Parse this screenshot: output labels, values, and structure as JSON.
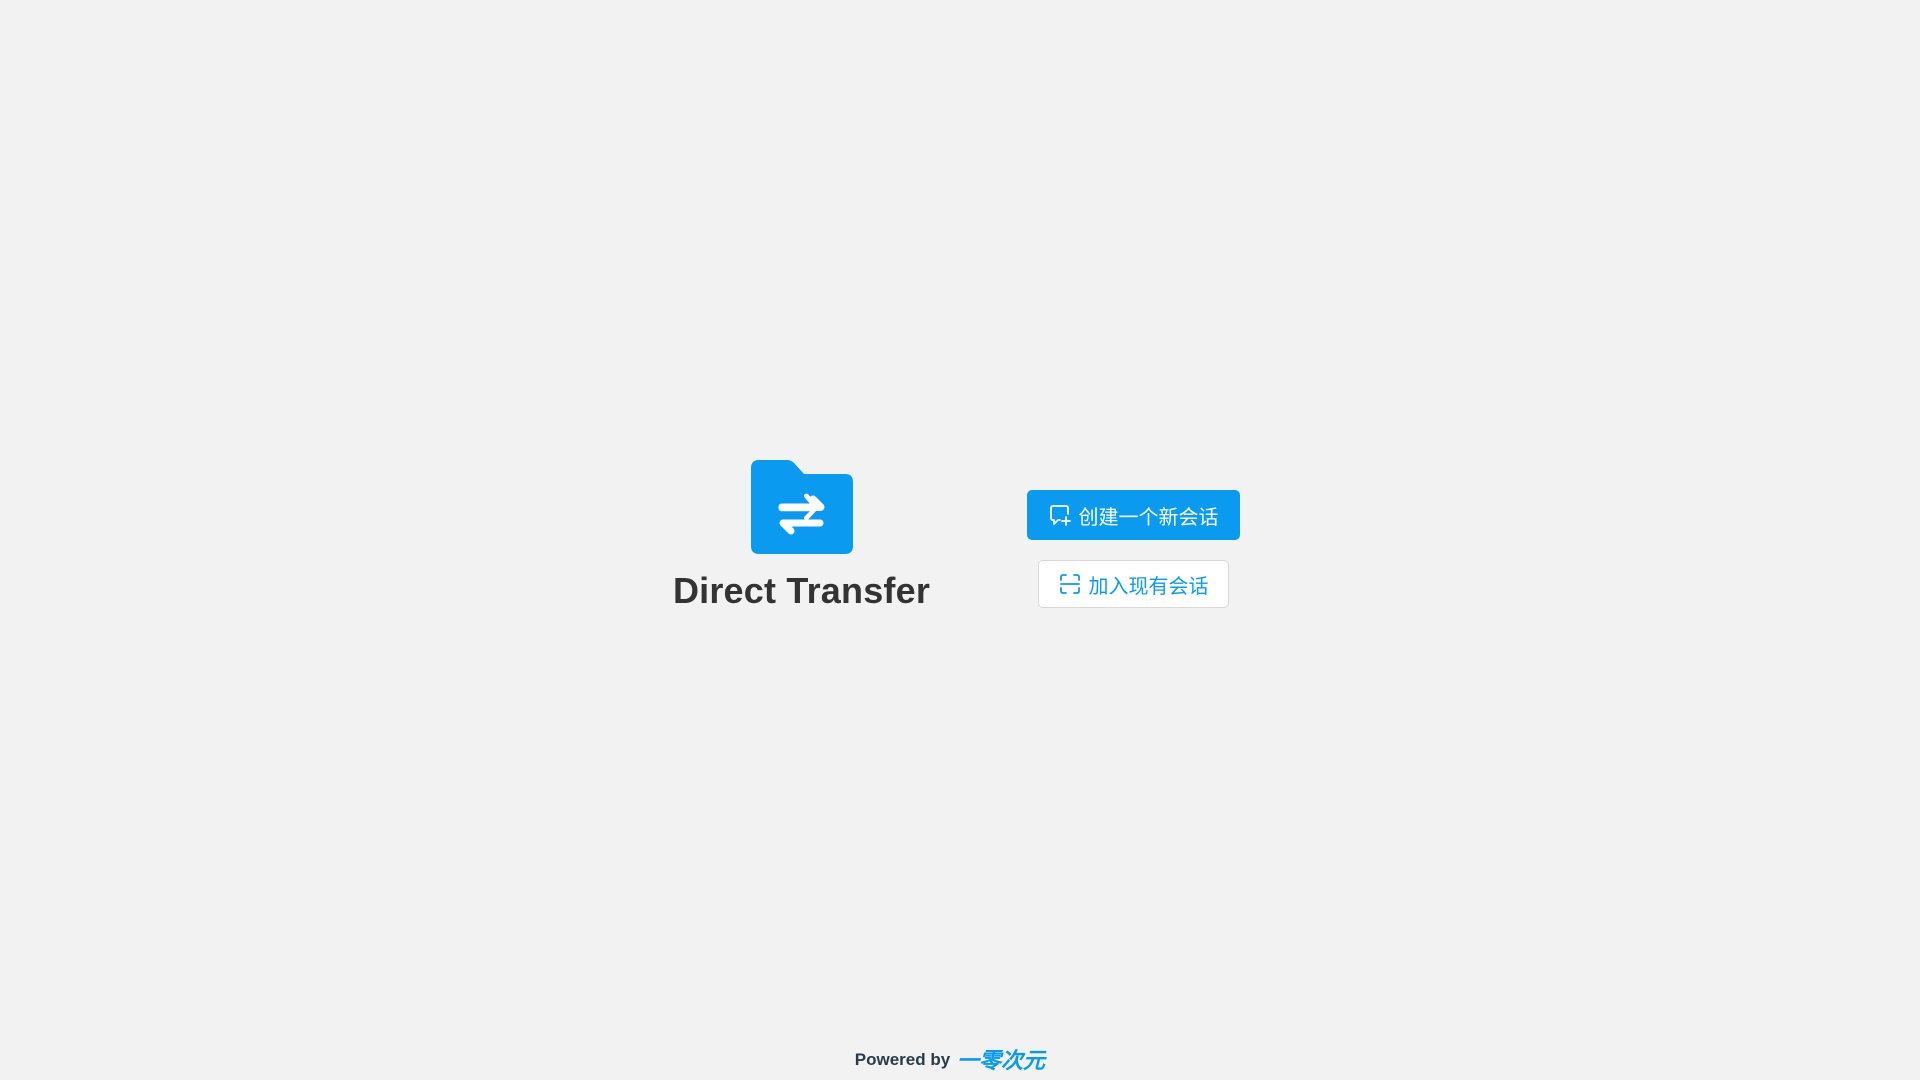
{
  "app": {
    "title": "Direct Transfer",
    "logo_icon": "folder-transfer-icon",
    "accent_color": "#0a9bf0"
  },
  "actions": {
    "create_session": {
      "label": "创建一个新会话",
      "icon": "new-chat-icon"
    },
    "join_session": {
      "label": "加入现有会话",
      "icon": "scan-icon"
    }
  },
  "footer": {
    "powered_by": "Powered by",
    "maker_name": "一零次元",
    "maker_logo_icon": "maker-logo"
  }
}
